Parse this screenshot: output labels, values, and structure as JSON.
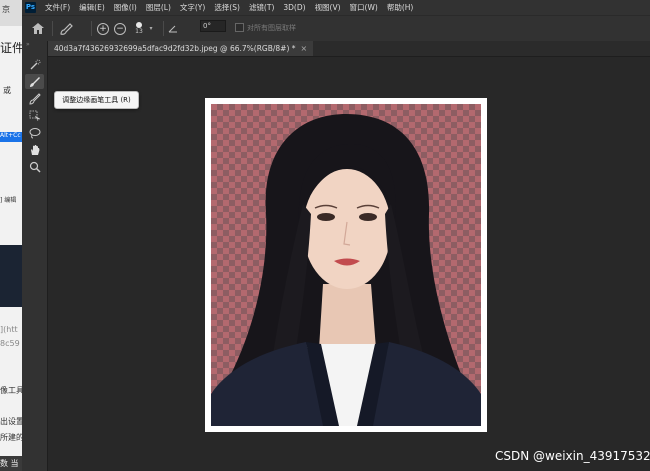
{
  "menubar": {
    "logo": "Ps",
    "items": [
      "文件(F)",
      "编辑(E)",
      "图像(I)",
      "图层(L)",
      "文字(Y)",
      "选择(S)",
      "滤镜(T)",
      "3D(D)",
      "视图(V)",
      "窗口(W)",
      "帮助(H)"
    ]
  },
  "options": {
    "brush_size": "13",
    "angle_value": "0°",
    "sample_all_layers": "对所有图层取样"
  },
  "document": {
    "tab_title": "40d3a7f43626932699a5dfac9d2fd32b.jpeg @ 66.7%(RGB/8#) *",
    "close": "×"
  },
  "tooltip": {
    "text": "调整边缘画笔工具 (R)"
  },
  "background_fragments": {
    "tab_text": "京",
    "heading": "证件",
    "f1": "或",
    "blue_btn": "Alt+Cc",
    "f2": "] 编辑",
    "f3": "](htt",
    "f4": "8c59",
    "f5": "像工具",
    "f6": "出设置",
    "f7": "所建的",
    "f8": "数 当"
  },
  "watermark": "CSDN @weixin_43917532",
  "colors": {
    "ps_panel": "#323232",
    "ps_workspace": "#282828",
    "ps_blue": "#31a8ff",
    "transparency_pink": "#b3696f"
  }
}
